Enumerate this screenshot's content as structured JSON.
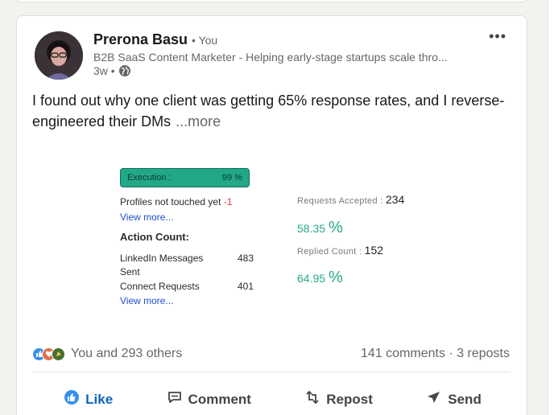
{
  "post": {
    "author_name": "Prerona Basu",
    "author_you": "• You",
    "headline": "B2B SaaS Content Marketer - Helping early-stage startups scale thro...",
    "time": "3w •",
    "text": "I found out why one client was getting 65% response rates, and I reverse-engineered their DMs",
    "see_more": "...more"
  },
  "image": {
    "execution_label": "Execution :",
    "execution_value": "99 %",
    "profiles_label": "Profiles not touched yet",
    "profiles_value": "-1",
    "view_more_1": "View more...",
    "action_count_title": "Action Count:",
    "linkedin_messages_label_1": "LinkedIn Messages",
    "linkedin_messages_label_2": "Sent",
    "linkedin_messages_value": "483",
    "connect_requests_label": "Connect Requests",
    "connect_requests_value": "401",
    "view_more_2": "View more...",
    "requests_accepted_label": "Requests Accepted :",
    "requests_accepted_value": "234",
    "accepted_pct_value": "58.35",
    "accepted_pct_sign": "%",
    "replied_label": "Replied Count :",
    "replied_value": "152",
    "replied_pct_value": "64.95",
    "replied_pct_sign": "%"
  },
  "social": {
    "reactions_text": "You and 293 others",
    "counts_text": "141 comments · 3 reposts"
  },
  "actions": {
    "like": "Like",
    "comment": "Comment",
    "repost": "Repost",
    "send": "Send"
  },
  "colors": {
    "like_blue": "#0a66c2",
    "execution_green": "#22a889",
    "percent_green": "#28a989"
  },
  "icons": [
    "globe-icon",
    "more-options-icon",
    "like-icon",
    "comment-icon",
    "repost-icon",
    "send-icon"
  ]
}
